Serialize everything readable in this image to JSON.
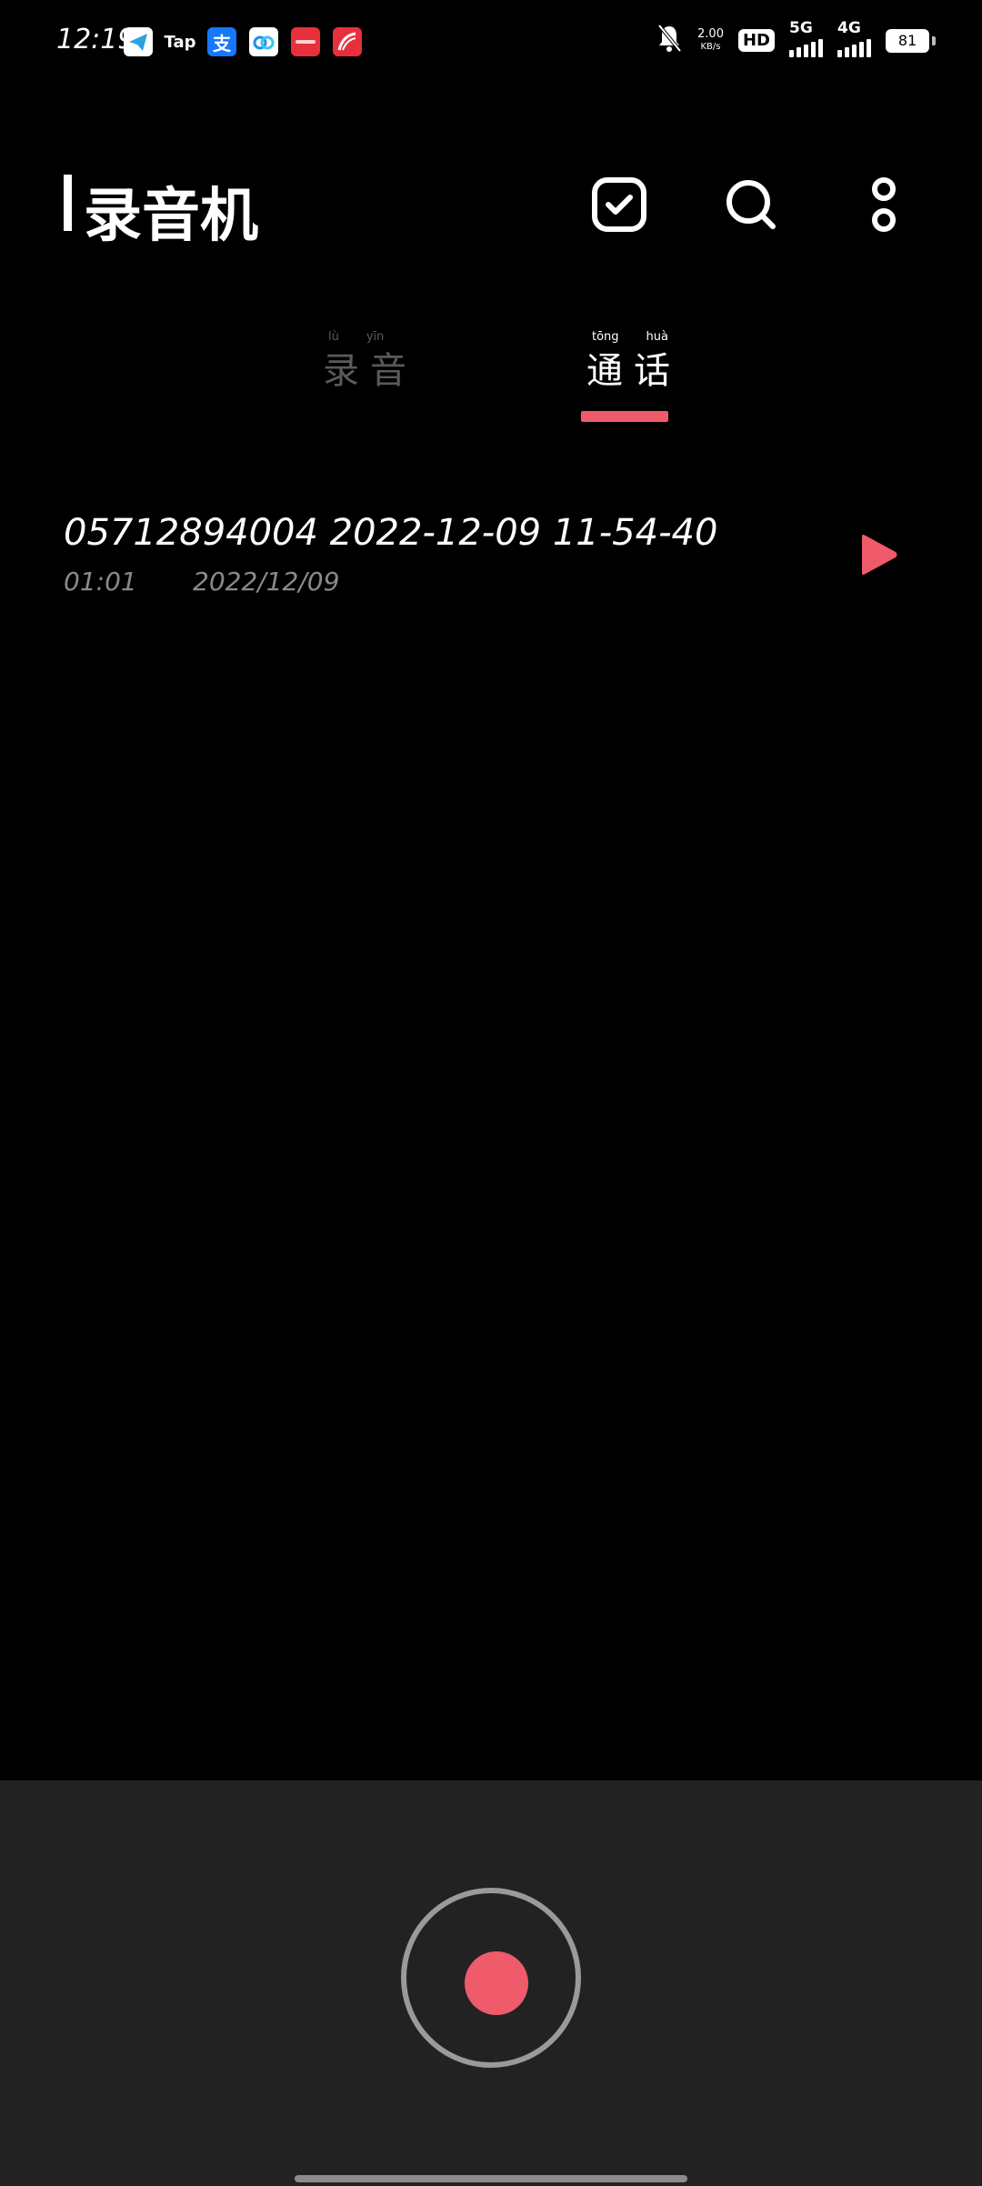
{
  "status_bar": {
    "time": "12:19",
    "notification_icons": [
      {
        "name": "telegram-icon",
        "text": "",
        "color": "#2aa3e0"
      },
      {
        "name": "taptap-icon",
        "text": "Tap",
        "color": "#000000"
      },
      {
        "name": "alipay-icon",
        "text": "支",
        "color": "#1677ff"
      },
      {
        "name": "baidu-netdisk-icon",
        "text": "",
        "color": "#ffffff"
      },
      {
        "name": "app-red-icon",
        "text": "",
        "color": "#e8303c"
      },
      {
        "name": "app-browser-icon",
        "text": "",
        "color": "#e8303c"
      }
    ],
    "net_speed_value": "2.00",
    "net_speed_unit": "KB/s",
    "hd_label": "HD",
    "signal_5g_label": "5G",
    "signal_4g_label": "4G",
    "battery_level": "81"
  },
  "header": {
    "title": "录音机"
  },
  "tabs": [
    {
      "label": "录音",
      "pinyin": [
        "lù",
        "yīn"
      ],
      "active": false
    },
    {
      "label": "通话",
      "pinyin": [
        "tōng",
        "huà"
      ],
      "active": true
    }
  ],
  "recordings": [
    {
      "title": "05712894004 2022-12-09 11-54-40",
      "duration": "01:01",
      "date": "2022/12/09"
    }
  ],
  "colors": {
    "accent": "#ef5b6a",
    "background": "#000000",
    "panel": "#222222",
    "inactive_tab": "#5a5a5a",
    "secondary_text": "#8a8a8a"
  }
}
